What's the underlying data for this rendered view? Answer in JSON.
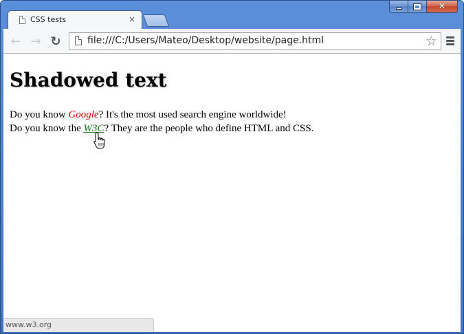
{
  "tab": {
    "title": "CSS tests",
    "close_glyph": "×"
  },
  "toolbar": {
    "back_glyph": "←",
    "forward_glyph": "→",
    "reload_glyph": "↻",
    "url": "file:///C:/Users/Mateo/Desktop/website/page.html",
    "star_glyph": "☆"
  },
  "window_controls": {
    "close_glyph": "✕"
  },
  "page": {
    "heading": "Shadowed text",
    "line1": {
      "before": "Do you know ",
      "link": "Google",
      "after": "? It's the most used search engine worldwide!"
    },
    "line2": {
      "before": "Do you know the ",
      "link": "W3C",
      "after": "? They are the people who define HTML and CSS."
    }
  },
  "status": {
    "text": "www.w3.org"
  },
  "colors": {
    "google_link": "#d30000",
    "w3c_link": "#117611",
    "title_bar": "#4a7fcf"
  },
  "icons": [
    "page-icon",
    "close-icon",
    "back-arrow-icon",
    "forward-arrow-icon",
    "reload-icon",
    "star-icon",
    "menu-icon",
    "hand-cursor-icon"
  ]
}
